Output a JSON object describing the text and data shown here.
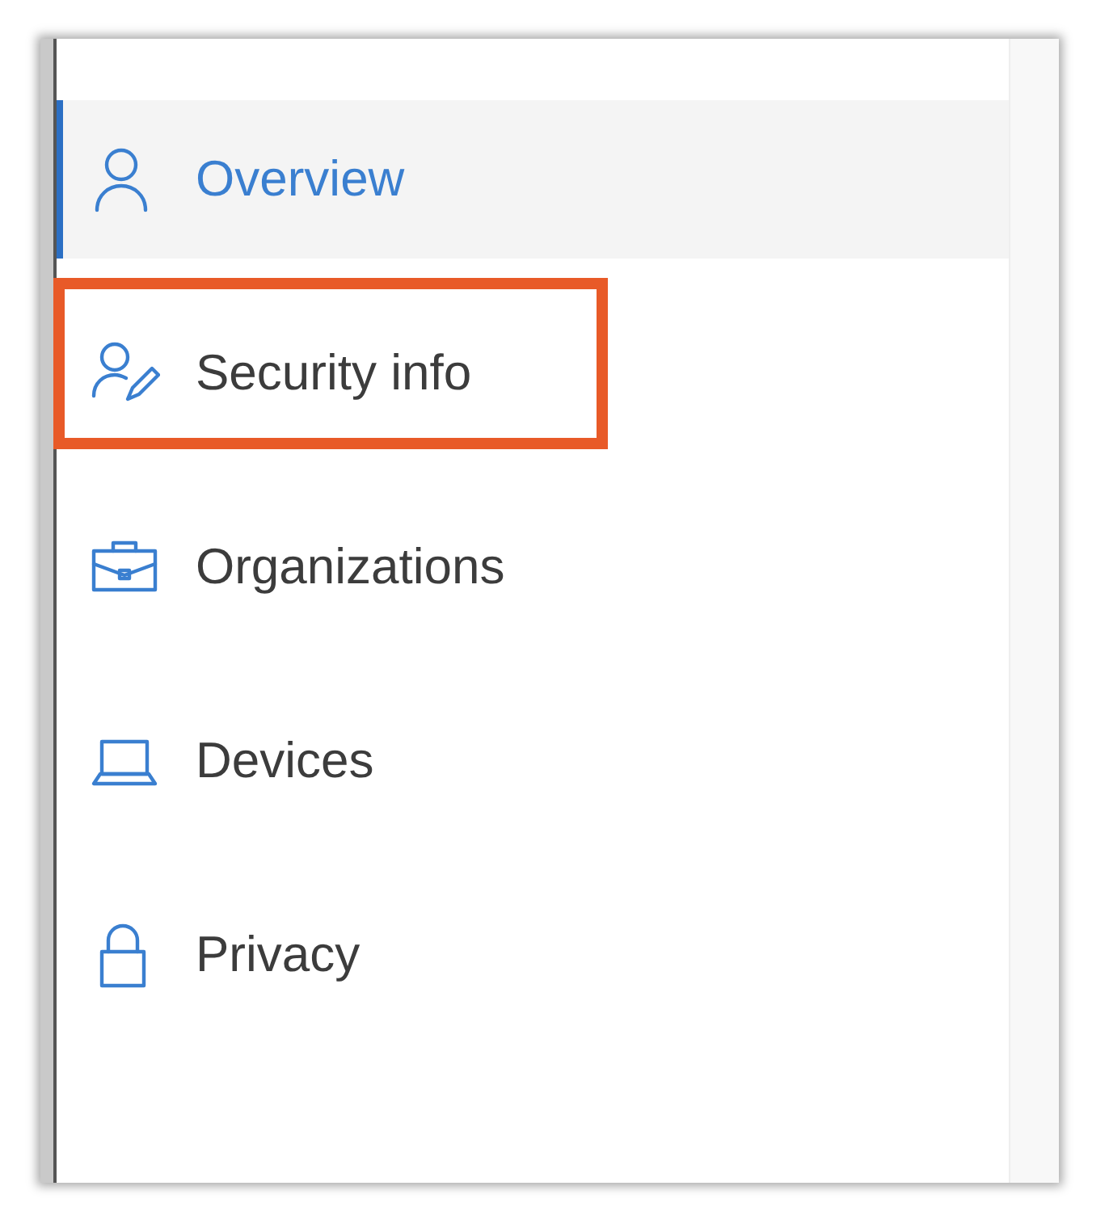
{
  "nav": {
    "items": [
      {
        "label": "Overview",
        "selected": true,
        "highlighted": false
      },
      {
        "label": "Security info",
        "selected": false,
        "highlighted": true
      },
      {
        "label": "Organizations",
        "selected": false,
        "highlighted": false
      },
      {
        "label": "Devices",
        "selected": false,
        "highlighted": false
      },
      {
        "label": "Privacy",
        "selected": false,
        "highlighted": false
      }
    ]
  }
}
